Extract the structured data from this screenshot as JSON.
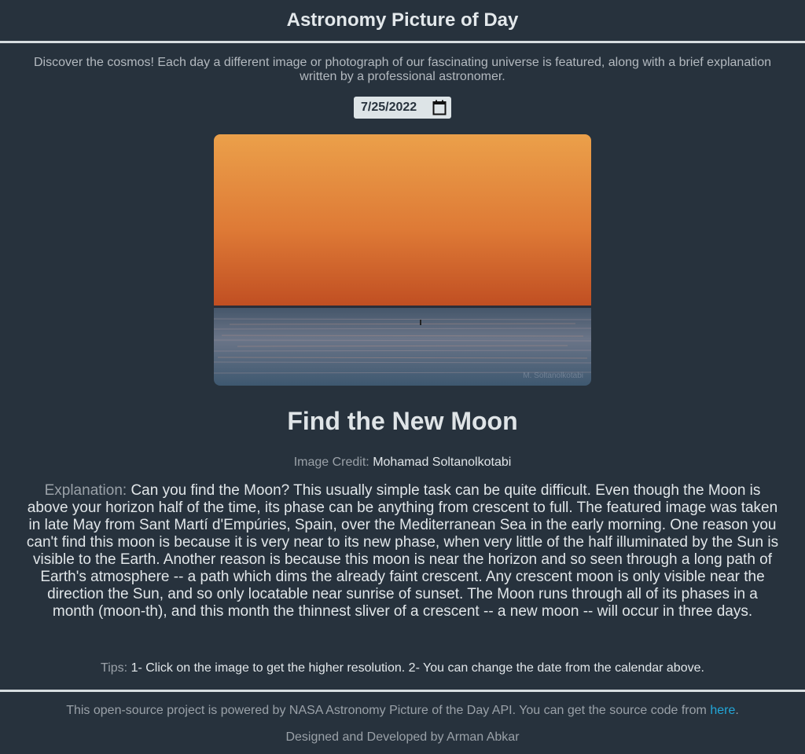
{
  "header": {
    "title": "Astronomy Picture of Day"
  },
  "intro": "Discover the cosmos! Each day a different image or photograph of our fascinating universe is featured, along with a brief explanation written by a professional astronomer.",
  "date_picker": {
    "value": "7/25/2022",
    "icon": "calendar-icon"
  },
  "picture": {
    "alt": "Sunrise over the Mediterranean Sea",
    "watermark": "M. Soltanolkotabi",
    "colors": {
      "sky_top": "#eba04a",
      "sky_bottom": "#c85a24",
      "sea": "#5e7084"
    }
  },
  "title": "Find the New Moon",
  "credit": {
    "label": "Image Credit:",
    "name": "Mohamad Soltanolkotabi"
  },
  "explanation": {
    "label": "Explanation:",
    "text": "Can you find the Moon? This usually simple task can be quite difficult. Even though the Moon is above your horizon half of the time, its phase can be anything from crescent to full. The featured image was taken in late May from Sant Martí d'Empúries, Spain, over the Mediterranean Sea in the early morning. One reason you can't find this moon is because it is very near to its new phase, when very little of the half illuminated by the Sun is visible to the Earth. Another reason is because this moon is near the horizon and so seen through a long path of Earth's atmosphere -- a path which dims the already faint crescent. Any crescent moon is only visible near the direction the Sun, and so only locatable near sunrise of sunset. The Moon runs through all of its phases in a month (moon-th), and this month the thinnest sliver of a crescent -- a new moon -- will occur in three days."
  },
  "tips": {
    "label": "Tips:",
    "text": "1- Click on the image to get the higher resolution. 2- You can change the date from the calendar above."
  },
  "footer": {
    "text_before": "This open-source project is powered by NASA Astronomy Picture of the Day API. You can get the source code from ",
    "link": "here",
    "text_after": ".",
    "designed_by": "Designed and Developed by Arman Abkar"
  }
}
